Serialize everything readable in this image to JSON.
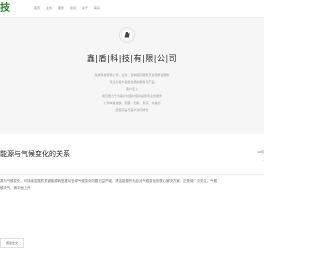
{
  "header": {
    "logo_text": "技",
    "nav": [
      "首页",
      "业务",
      "服务",
      "新闻",
      "关于",
      "联系"
    ]
  },
  "hero": {
    "title": "鑫|盾|科|技|有|限|公|司",
    "lines": [
      "鑫盾科技有限公司，业务：咨询顾问服务及资源整合服务",
      "专注为客户提供优质的服务与产品",
      "客户至上",
      "我们致力于为客户创造价值并提供专业的服务",
      "公司本着诚信、勤奋、创新、务实、共赢的",
      "经营宗旨与客户共同成长"
    ]
  },
  "article": {
    "title": "能源与气候变化的关系",
    "date": "12月",
    "arrow": "›",
    "excerpt_lines": [
      "源与气候变化，可持续发展的关键能源转型推动全球气候变化问题日益严峻，清洁能源作为应对气候变化的核心解决方案，正受到广泛关注。气候",
      "候天气、海平面上升"
    ],
    "read_more": "阅读全文"
  }
}
